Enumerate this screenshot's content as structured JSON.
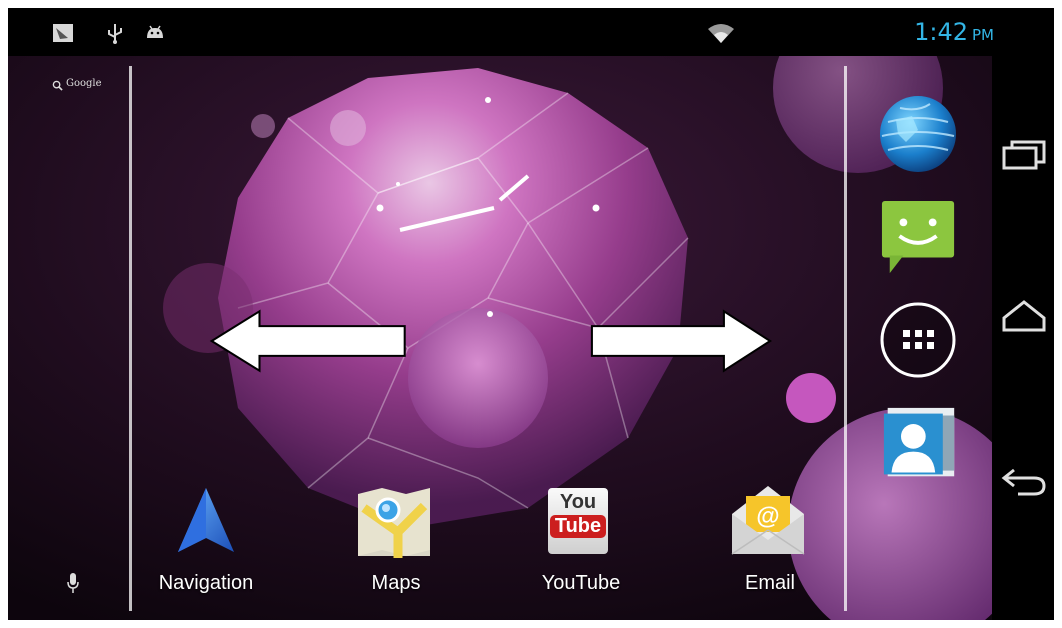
{
  "status_bar": {
    "icons": [
      "gallery-icon",
      "usb-icon",
      "android-debug-icon",
      "wifi-icon"
    ],
    "time": "1:42",
    "ampm": "PM",
    "accent_color": "#33b5e5"
  },
  "search_widget": {
    "label": "Google",
    "icon": "search-icon",
    "voice_icon": "microphone-icon"
  },
  "dock": [
    {
      "label": "Navigation",
      "icon": "navigation-icon"
    },
    {
      "label": "Maps",
      "icon": "maps-icon"
    },
    {
      "label": "YouTube",
      "icon": "youtube-icon",
      "icon_text_top": "You",
      "icon_text_bottom": "Tube"
    },
    {
      "label": "Email",
      "icon": "email-icon",
      "icon_text": "@"
    }
  ],
  "favorites": [
    {
      "icon": "browser-icon"
    },
    {
      "icon": "messaging-icon"
    },
    {
      "icon": "all-apps-icon"
    },
    {
      "icon": "people-icon"
    }
  ],
  "nav_buttons": [
    "recent-apps-icon",
    "home-icon",
    "back-icon"
  ],
  "overlay_arrows": [
    "left-arrow-icon",
    "right-arrow-icon"
  ]
}
